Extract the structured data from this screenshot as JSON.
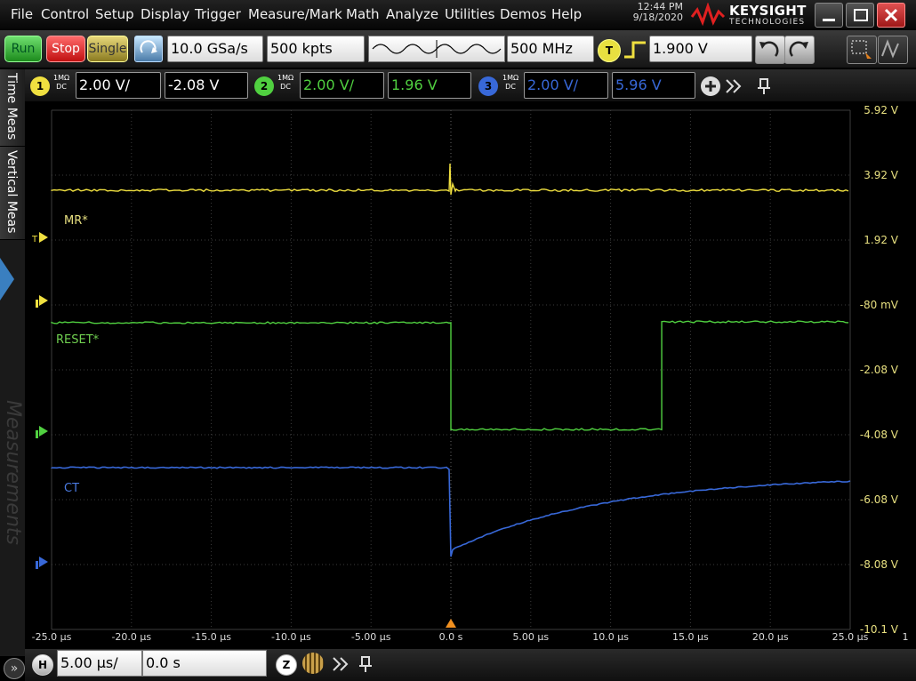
{
  "menu": [
    "File",
    "Control",
    "Setup",
    "Display",
    "Trigger",
    "Measure/Mark",
    "Math",
    "Analyze",
    "Utilities",
    "Demos",
    "Help"
  ],
  "datetime": {
    "time": "12:44 PM",
    "date": "9/18/2020"
  },
  "logo": {
    "name": "KEYSIGHT",
    "sub": "TECHNOLOGIES"
  },
  "toolbar": {
    "run": "Run",
    "stop": "Stop",
    "single": "Single",
    "sample_rate": "10.0 GSa/s",
    "memory": "500 kpts",
    "bandwidth": "500 MHz",
    "trigger_badge": "T",
    "trigger_level": "1.900 V"
  },
  "channels": [
    {
      "num": "1",
      "coupling_top": "1MΩ",
      "coupling_bot": "DC",
      "scale": "2.00 V/",
      "offset": "-2.08 V",
      "color": "#f0e040"
    },
    {
      "num": "2",
      "coupling_top": "1MΩ",
      "coupling_bot": "DC",
      "scale": "2.00 V/",
      "offset": "1.96 V",
      "color": "#50d040"
    },
    {
      "num": "3",
      "coupling_top": "1MΩ",
      "coupling_bot": "DC",
      "scale": "2.00 V/",
      "offset": "5.96 V",
      "color": "#3868d8"
    }
  ],
  "side_tabs": [
    "Time Meas",
    "Vertical Meas"
  ],
  "side_ghost": "Measurements",
  "plot": {
    "y_labels": [
      "5.92 V",
      "3.92 V",
      "1.92 V",
      "-80 mV",
      "-2.08 V",
      "-4.08 V",
      "-6.08 V",
      "-8.08 V",
      "-10.1 V"
    ],
    "x_labels": [
      "-25.0 µs",
      "-20.0 µs",
      "-15.0 µs",
      "-10.0 µs",
      "-5.00 µs",
      "0.0 s",
      "5.00 µs",
      "10.0 µs",
      "15.0 µs",
      "20.0 µs",
      "25.0 µs"
    ],
    "x_extra": "1",
    "trace_labels": [
      "MR*",
      "RESET*",
      "CT"
    ],
    "trigger_marker": "T"
  },
  "bottombar": {
    "h_badge": "H",
    "timebase": "5.00 µs/",
    "position": "0.0 s",
    "zoom_badge": "Z"
  },
  "colors": {
    "ch1": "#f0e040",
    "ch2": "#50d040",
    "ch3": "#3868d8",
    "grid": "#3c3c3c",
    "label_yellow": "#e8e080"
  }
}
